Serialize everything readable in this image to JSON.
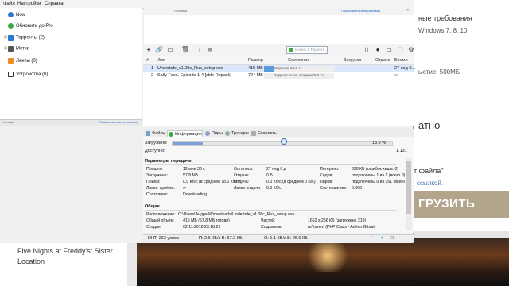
{
  "menu": [
    "Файл",
    "Настройки",
    "Справка"
  ],
  "sidebar": {
    "items": [
      {
        "label": "Now",
        "icon": "clock-icon",
        "color": "#2a77d4"
      },
      {
        "label": "Обновить до Pro",
        "icon": "pro-icon",
        "color": "#3aa845"
      },
      {
        "label": "Торренты (2)",
        "icon": "torrents-icon",
        "color": "#2a77d4"
      },
      {
        "label": "Метки",
        "icon": "label-icon",
        "color": "#555555"
      },
      {
        "label": "Ленты (0)",
        "icon": "rss-icon",
        "color": "#f08a24"
      },
      {
        "label": "Устройства (0)",
        "icon": "device-icon",
        "color": "#333333"
      }
    ],
    "divider_left": "Реклама",
    "divider_link": "Пожаловаться на рекламу"
  },
  "ad_header": {
    "left": "Реклама",
    "link": "Пожаловаться на рекламу",
    "close": "×"
  },
  "search": {
    "placeholder": "Искать в Торрент..."
  },
  "list": {
    "columns": [
      "#",
      "Имя",
      "Размер",
      "Состояние",
      "Загрузка",
      "Отдача",
      "Время"
    ],
    "rows": [
      {
        "num": "1",
        "name": "Undertale_v1.08c_Rus_setup.exe",
        "size": "415 МБ",
        "status": "Загрузка 13.9 %",
        "progress": 13.9,
        "time": "27 нед 0..."
      },
      {
        "num": "2",
        "name": "Sally Face. Episode 1-4 [cble Repack]",
        "size": "724 МБ",
        "status": "Подключение к пирам 0.0 %",
        "progress": 0.0,
        "time": "∞"
      }
    ]
  },
  "tabs": [
    "Файлы",
    "Информация",
    "Пиры",
    "Трекеры",
    "Скорость"
  ],
  "info": {
    "downloaded_label": "Загружено:",
    "downloaded_pct": "13.9 %",
    "downloaded_value": 13.9,
    "available_label": "Доступно:",
    "available_value": "1.131",
    "transfer_title": "Параметры передачи:",
    "c1": [
      [
        "Прошло:",
        "12 мин 33 с"
      ],
      [
        "Загружено:",
        "57.8 МБ"
      ],
      [
        "Приём:",
        "0.0 Кб/с (в среднем 78.6 Кб/с)"
      ],
      [
        "Лимит приёма:",
        "∞"
      ],
      [
        "Состояние:",
        "Downloading"
      ]
    ],
    "c2": [
      [
        "Осталось:",
        "27 нед 0 д"
      ],
      [
        "Отдано:",
        "0 Б"
      ],
      [
        "Отдача:",
        "0.0 Кб/с (в среднем 0 Б/с)"
      ],
      [
        "Лимит отдачи:",
        "0.0 Кб/с"
      ]
    ],
    "c3": [
      [
        "Потеряно:",
        "390 КБ (ошибок хеша: 0)"
      ],
      [
        "Сидов:",
        "подключены 1 из 1 (всего 0)"
      ],
      [
        "Пиров:",
        "подключены 0 из 751 (всего 4)"
      ],
      [
        "Соотношение:",
        "0.000"
      ]
    ],
    "general_title": "Общие",
    "g": [
      [
        "Расположение:",
        "C:\\Users\\Андрей\\Downloads\\Undertale_v1.08c_Rus_setup.exe"
      ],
      [
        "Общий объём:",
        "415 МБ (57.8 МБ готово)"
      ],
      [
        "Создан:",
        "02.11.2018 23:18:29"
      ]
    ],
    "g2": [
      [
        "Частей:",
        "1662 x 256 КБ (загружено 219)"
      ],
      [
        "Создатель:",
        "ruTorrent (PHP Class - Adrien Gibrat)"
      ]
    ]
  },
  "status_bar": {
    "dht": "DHT: 263 узлов",
    "speed": "П: 2.6 КБ/с В: 67.2 КБ",
    "up": "О: 1.1 КБ/с В: 26.0 КБ"
  },
  "background": {
    "r1": "ные требования",
    "r2": "Windows 7, 8, 10",
    "r3": "ыстие: 500МБ",
    "r4": "атно",
    "r5": "т файла\"",
    "r6": "ссылкой.",
    "banner": "ГРУЗИТЬ",
    "bottom_title": "Five Nights at Freddy's: Sister Location"
  }
}
